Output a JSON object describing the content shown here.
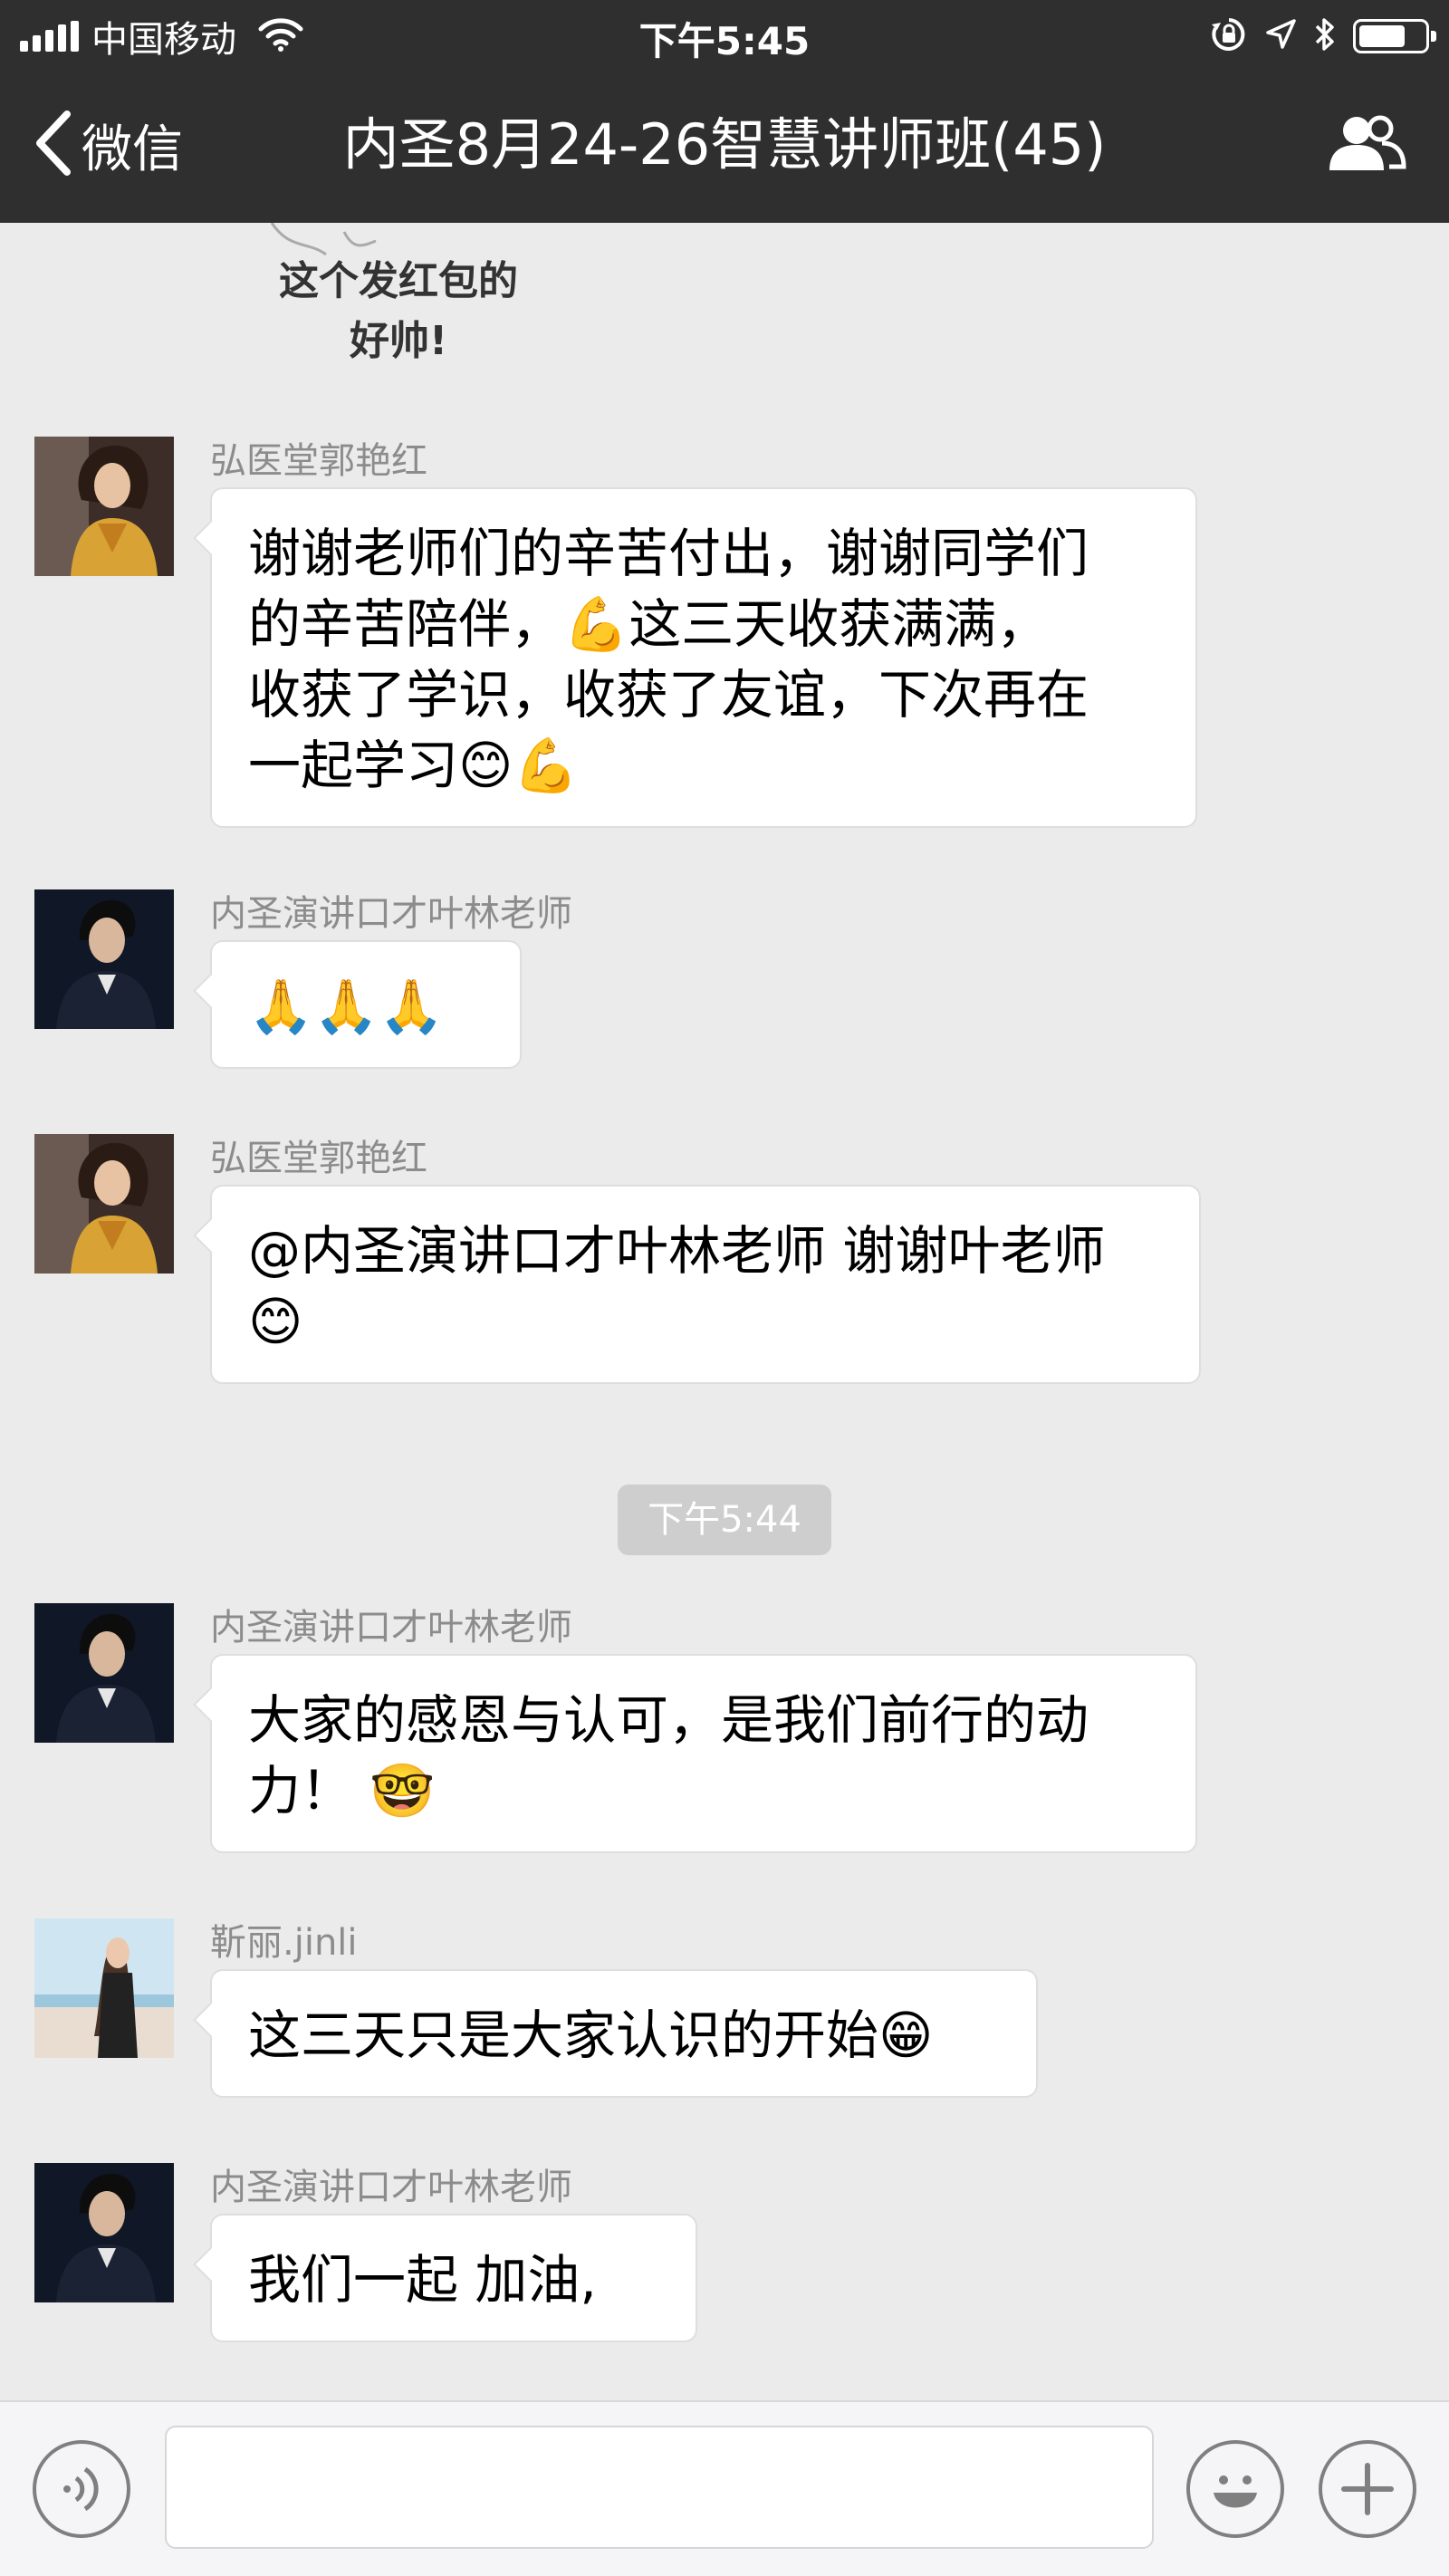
{
  "status_bar": {
    "carrier": "中国移动",
    "time": "下午5:45",
    "battery_level": 0.72,
    "icons": [
      "signal-icon",
      "wifi-icon",
      "orientation-lock-icon",
      "location-icon",
      "bluetooth-icon",
      "battery-icon"
    ]
  },
  "nav": {
    "back_label": "微信",
    "title": "内圣8月24-26智慧讲师班(45)",
    "icons": [
      "chevron-left-icon",
      "group-members-icon"
    ]
  },
  "sticker": {
    "text": "这个发红包的\n好帅!"
  },
  "messages": [
    {
      "sender": "弘医堂郭艳红",
      "text": "谢谢老师们的辛苦付出，谢谢同学们\n的辛苦陪伴，💪这三天收获满满，\n收获了学识，收获了友谊，下次再在\n一起学习😊💪"
    },
    {
      "sender": "内圣演讲口才叶林老师",
      "text": "🙏🙏🙏"
    },
    {
      "sender": "弘医堂郭艳红",
      "text": "@内圣演讲口才叶林老师 谢谢叶老师\n😊"
    },
    {
      "sender": "内圣演讲口才叶林老师",
      "text": "大家的感恩与认可，是我们前行的动\n力！ 🤓"
    },
    {
      "sender": "靳丽.jinli",
      "text": "这三天只是大家认识的开始😁"
    },
    {
      "sender": "内圣演讲口才叶林老师",
      "text": "我们一起 加油,"
    }
  ],
  "timestamp_divider": "下午5:44",
  "input_bar": {
    "placeholder": "",
    "icons": [
      "voice-icon",
      "emoji-icon",
      "plus-icon"
    ]
  }
}
